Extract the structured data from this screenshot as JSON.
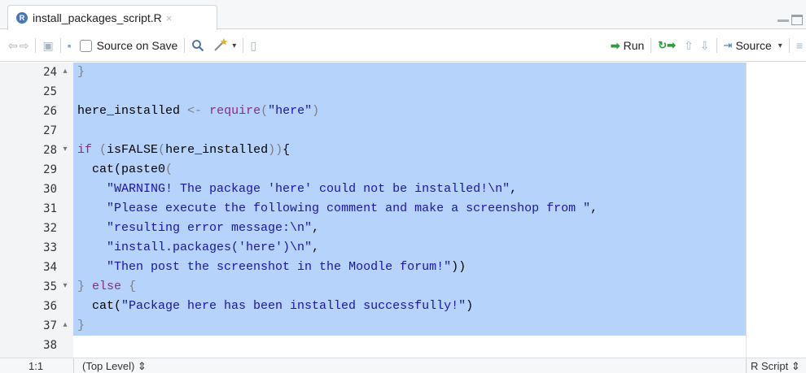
{
  "tab": {
    "title": "install_packages_script.R",
    "close": "×"
  },
  "toolbar": {
    "source_on_save": "Source on Save",
    "run": "Run",
    "source": "Source"
  },
  "editor": {
    "lines": [
      {
        "n": "24",
        "fold": "▴",
        "segments": [
          {
            "t": "}",
            "c": "br"
          }
        ]
      },
      {
        "n": "25",
        "fold": "",
        "segments": []
      },
      {
        "n": "26",
        "fold": "",
        "segments": [
          {
            "t": "here_installed ",
            "c": ""
          },
          {
            "t": "<-",
            "c": "op"
          },
          {
            "t": " ",
            "c": ""
          },
          {
            "t": "require",
            "c": "kw"
          },
          {
            "t": "(",
            "c": "br"
          },
          {
            "t": "\"here\"",
            "c": "str"
          },
          {
            "t": ")",
            "c": "br"
          }
        ]
      },
      {
        "n": "27",
        "fold": "",
        "segments": []
      },
      {
        "n": "28",
        "fold": "▾",
        "segments": [
          {
            "t": "if",
            "c": "kw"
          },
          {
            "t": " ",
            "c": ""
          },
          {
            "t": "(",
            "c": "br"
          },
          {
            "t": "isFALSE",
            "c": ""
          },
          {
            "t": "(",
            "c": "br"
          },
          {
            "t": "here_installed",
            "c": ""
          },
          {
            "t": "))",
            "c": "br"
          },
          {
            "t": "{",
            "c": ""
          }
        ]
      },
      {
        "n": "29",
        "fold": "",
        "segments": [
          {
            "t": "  cat(paste0",
            "c": ""
          },
          {
            "t": "(",
            "c": "br"
          }
        ]
      },
      {
        "n": "30",
        "fold": "",
        "segments": [
          {
            "t": "    ",
            "c": ""
          },
          {
            "t": "\"WARNING! The package 'here' could not be installed!\\n\"",
            "c": "str"
          },
          {
            "t": ",",
            "c": ""
          }
        ]
      },
      {
        "n": "31",
        "fold": "",
        "segments": [
          {
            "t": "    ",
            "c": ""
          },
          {
            "t": "\"Please execute the following comment and make a screenshop from \"",
            "c": "str"
          },
          {
            "t": ",",
            "c": ""
          }
        ]
      },
      {
        "n": "32",
        "fold": "",
        "segments": [
          {
            "t": "    ",
            "c": ""
          },
          {
            "t": "\"resulting error message:\\n\"",
            "c": "str"
          },
          {
            "t": ",",
            "c": ""
          }
        ]
      },
      {
        "n": "33",
        "fold": "",
        "segments": [
          {
            "t": "    ",
            "c": ""
          },
          {
            "t": "\"install.packages('here')\\n\"",
            "c": "str"
          },
          {
            "t": ",",
            "c": ""
          }
        ]
      },
      {
        "n": "34",
        "fold": "",
        "segments": [
          {
            "t": "    ",
            "c": ""
          },
          {
            "t": "\"Then post the screenshot in the Moodle forum!\"",
            "c": "str"
          },
          {
            "t": "))",
            "c": ""
          }
        ]
      },
      {
        "n": "35",
        "fold": "▾",
        "segments": [
          {
            "t": "}",
            "c": "br"
          },
          {
            "t": " ",
            "c": ""
          },
          {
            "t": "else",
            "c": "kw"
          },
          {
            "t": " ",
            "c": ""
          },
          {
            "t": "{",
            "c": "br"
          }
        ]
      },
      {
        "n": "36",
        "fold": "",
        "segments": [
          {
            "t": "  cat(",
            "c": ""
          },
          {
            "t": "\"Package here has been installed successfully!\"",
            "c": "str"
          },
          {
            "t": ")",
            "c": ""
          }
        ]
      },
      {
        "n": "37",
        "fold": "▴",
        "segments": [
          {
            "t": "}",
            "c": "br"
          }
        ]
      },
      {
        "n": "38",
        "fold": "",
        "segments": []
      }
    ]
  },
  "status": {
    "position": "1:1",
    "scope": "(Top Level) ⇕",
    "file_type": "R Script ⇕"
  }
}
